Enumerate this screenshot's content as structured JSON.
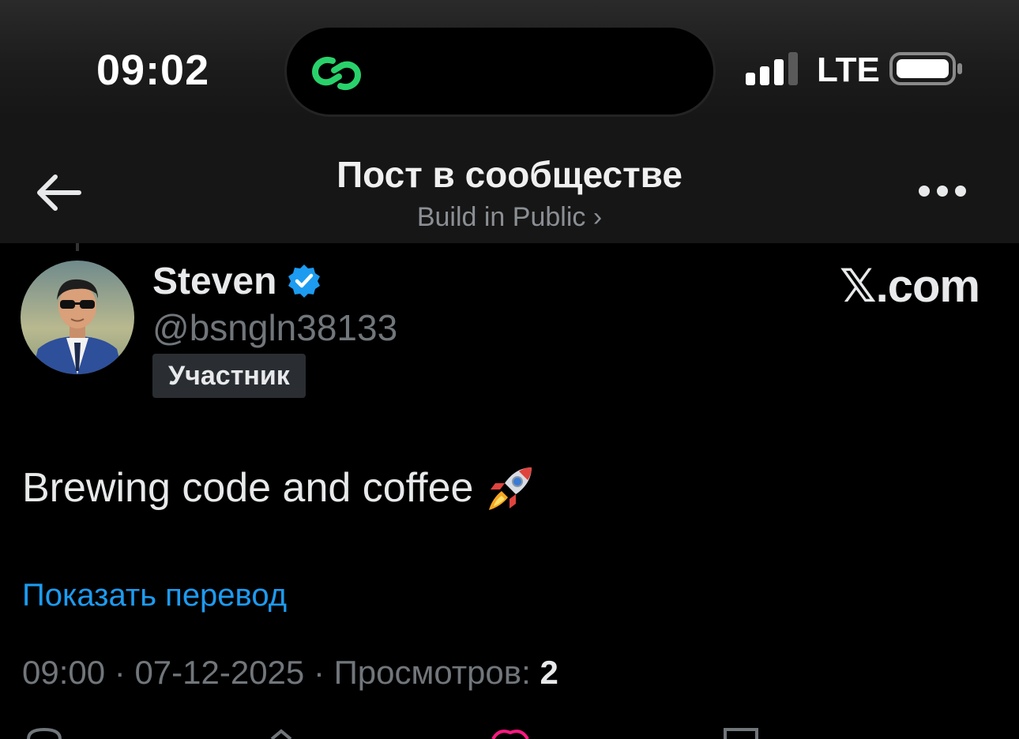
{
  "status_bar": {
    "time": "09:02",
    "network": "LTE"
  },
  "nav": {
    "title": "Пост в сообществе",
    "community": "Build in Public ›"
  },
  "post": {
    "author_name": "Steven",
    "handle": "@bsngln38133",
    "role_badge": "Участник",
    "watermark": "𝕏.com",
    "text": "Brewing code and coffee",
    "translate_link": "Показать перевод",
    "time": "09:00",
    "date": "07-12-2025",
    "views_label": "Просмотров:",
    "views_count": "2",
    "separator": " · "
  },
  "colors": {
    "link": "#1d9bf0",
    "verified": "#1d9bf0",
    "island_icon": "#29d16b",
    "secondary_text": "#71767b"
  }
}
